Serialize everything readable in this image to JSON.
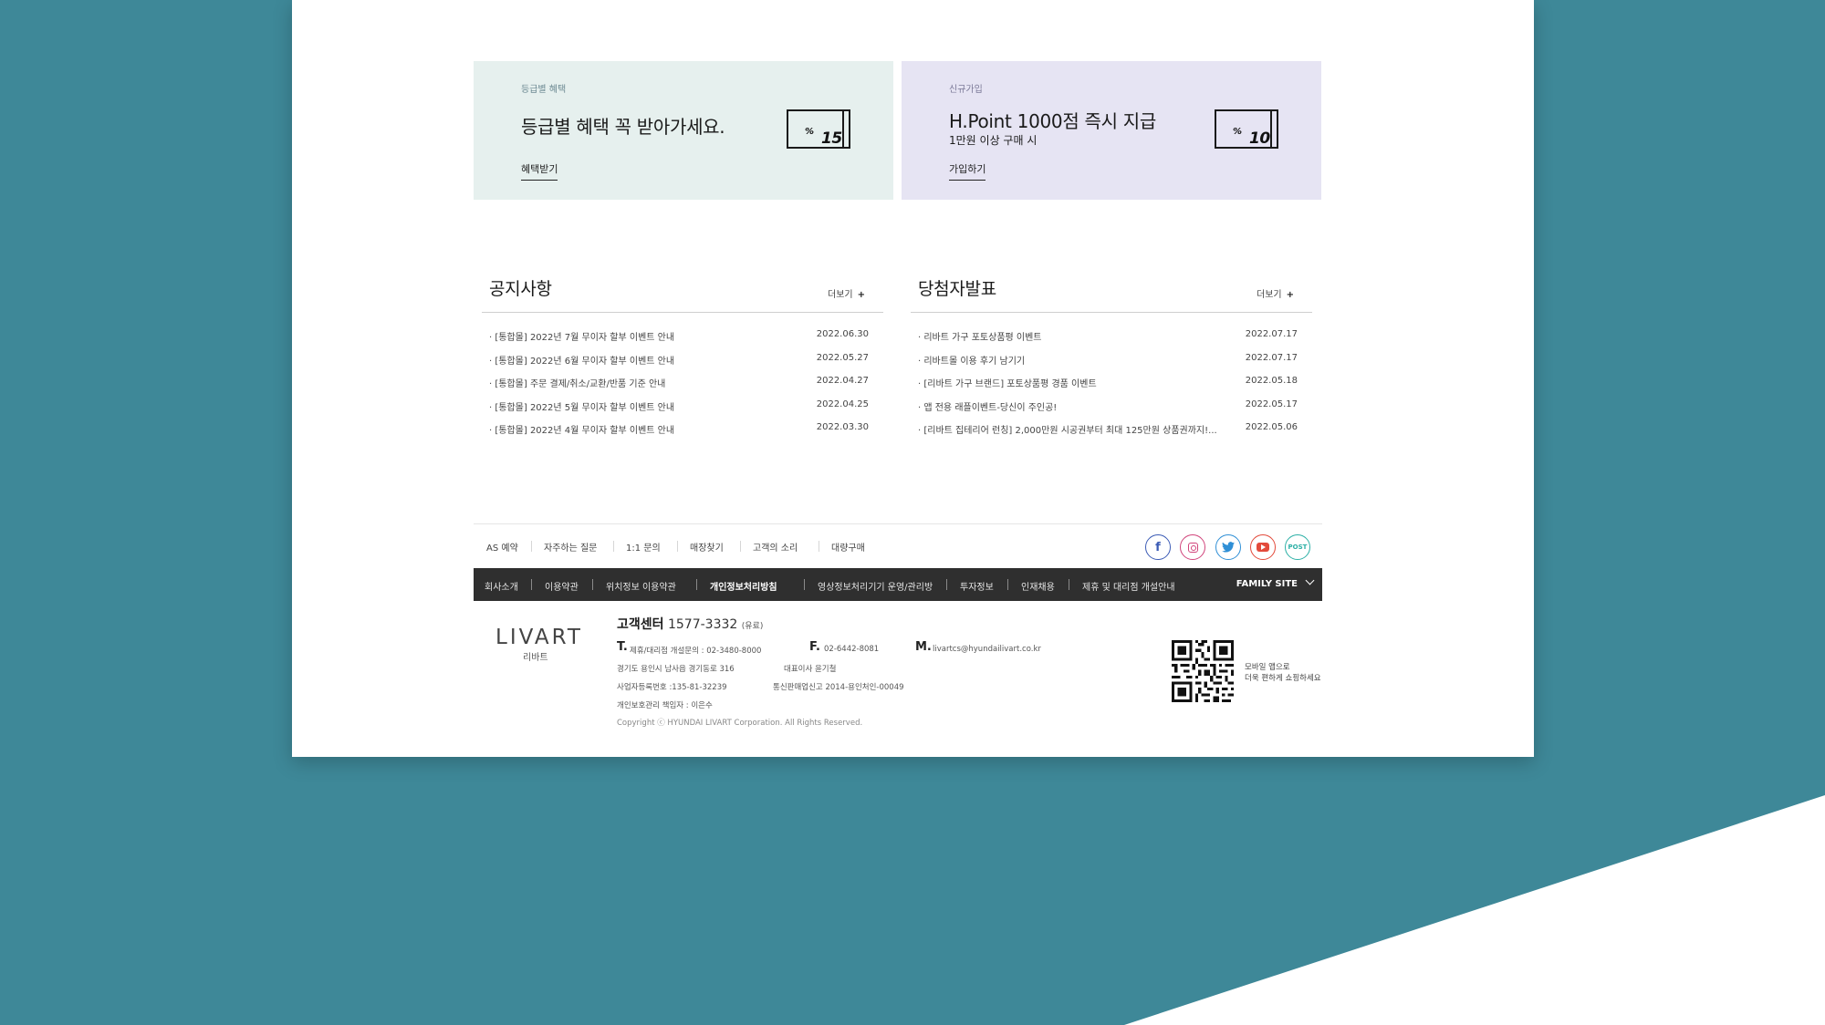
{
  "promos": [
    {
      "category": "등급별 혜택",
      "title": "등급별 혜택 꼭 받아가세요.",
      "subtitle": "",
      "link": "혜택받기",
      "coupon_value": "15",
      "coupon_unit": "%"
    },
    {
      "category": "신규가입",
      "title": "H.Point 1000점 즉시 지급",
      "subtitle": "1만원 이상 구매 시",
      "link": "가입하기",
      "coupon_value": "10",
      "coupon_unit": "%"
    }
  ],
  "notice": {
    "title": "공지사항",
    "more": "더보기",
    "rows": [
      {
        "text": "· [통합몰] 2022년 7월 무이자 할부 이벤트 안내",
        "date": "2022.06.30"
      },
      {
        "text": "· [통합몰] 2022년 6월 무이자 할부 이벤트 안내",
        "date": "2022.05.27"
      },
      {
        "text": "· [통합몰] 주문 결제/취소/교환/반품 기준 안내",
        "date": "2022.04.27"
      },
      {
        "text": "· [통합몰] 2022년 5월 무이자 할부 이벤트 안내",
        "date": "2022.04.25"
      },
      {
        "text": "· [통합몰] 2022년 4월 무이자 할부 이벤트 안내",
        "date": "2022.03.30"
      }
    ]
  },
  "winners": {
    "title": "당첨자발표",
    "more": "더보기",
    "rows": [
      {
        "text": "· 리바트 가구 포토상품평 이벤트",
        "date": "2022.07.17"
      },
      {
        "text": "· 리바트몰 이용 후기 남기기",
        "date": "2022.07.17"
      },
      {
        "text": "· [리바트 가구 브랜드] 포토상품평 경품 이벤트",
        "date": "2022.05.18"
      },
      {
        "text": "· 앱 전용 래플이벤트-당신이 주인공!",
        "date": "2022.05.17"
      },
      {
        "text": "· [리바트 집테리어 런칭] 2,000만원 시공권부터 최대 125만원 상품권까지!...",
        "date": "2022.05.06"
      }
    ]
  },
  "footer": {
    "links": [
      "AS 예약",
      "자주하는 질문",
      "1:1 문의",
      "매장찾기",
      "고객의 소리",
      "대량구매"
    ],
    "sns": [
      {
        "icon": "facebook-icon",
        "color": "#3b5bb5"
      },
      {
        "icon": "instagram-icon",
        "color": "#d1447b"
      },
      {
        "icon": "twitter-icon",
        "color": "#2f8fd6"
      },
      {
        "icon": "youtube-icon",
        "color": "#e34a3b"
      },
      {
        "icon": "post-icon",
        "label": "POST",
        "color": "#2cb0a6"
      }
    ],
    "bar_links": [
      "회사소개",
      "이용약관",
      "위치정보 이용약관",
      "개인정보처리방침",
      "영상정보처리기기 운영/관리방",
      "투자정보",
      "인재채용",
      "제휴 및 대리점 개설안내"
    ],
    "family_site": "FAMILY SITE",
    "logo": "LIVART",
    "logo_sub": "리바트",
    "cs_label": "고객센터",
    "cs_number": "1577-3332",
    "cs_note": "(유료)",
    "tel_key": "T.",
    "tel_val": "제휴/대리점 개설문의 : 02-3480-8000",
    "fax_key": "F.",
    "fax_val": "02-6442-8081",
    "mail_key": "M.",
    "mail_val": "livartcs@hyundailivart.co.kr",
    "address": "경기도 용인시 남사읍 경기동로 316",
    "ceo": "대표이사 윤기철",
    "biz_no": "사업자등록번호 :135-81-32239",
    "mail_order": "통신판매업신고 2014-용인처인-00049",
    "privacy_officer": "개인보호관리 책임자 : 이은수",
    "copyright": "Copyright ⓒ HYUNDAI LIVART Corporation. All Rights Reserved.",
    "qr_text_1": "모바일 앱으로",
    "qr_text_2": "더욱 편하게 쇼핑하세요"
  }
}
